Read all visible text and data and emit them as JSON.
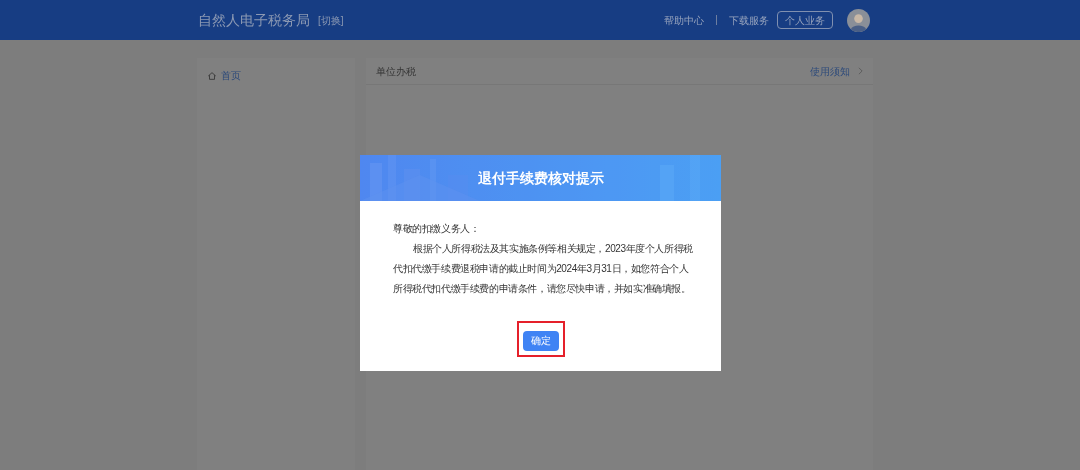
{
  "header": {
    "title": "自然人电子税务局",
    "switch": "[切换]",
    "links": [
      "帮助中心",
      "下载服务"
    ],
    "button": "个人业务"
  },
  "sidebar": {
    "items": [
      {
        "label": "首页",
        "selected": true
      }
    ]
  },
  "main": {
    "title": "单位办税",
    "notice_link": "使用须知"
  },
  "dialog": {
    "title": "退付手续费核对提示",
    "greeting": "尊敬的扣缴义务人：",
    "body": "根据个人所得税法及其实施条例等相关规定，2023年度个人所得税代扣代缴手续费退税申请的截止时间为2024年3月31日，如您符合个人所得税代扣代缴手续费的申请条件，请您尽快申请，并如实准确填报。",
    "confirm": "确定",
    "highlighted": true
  }
}
